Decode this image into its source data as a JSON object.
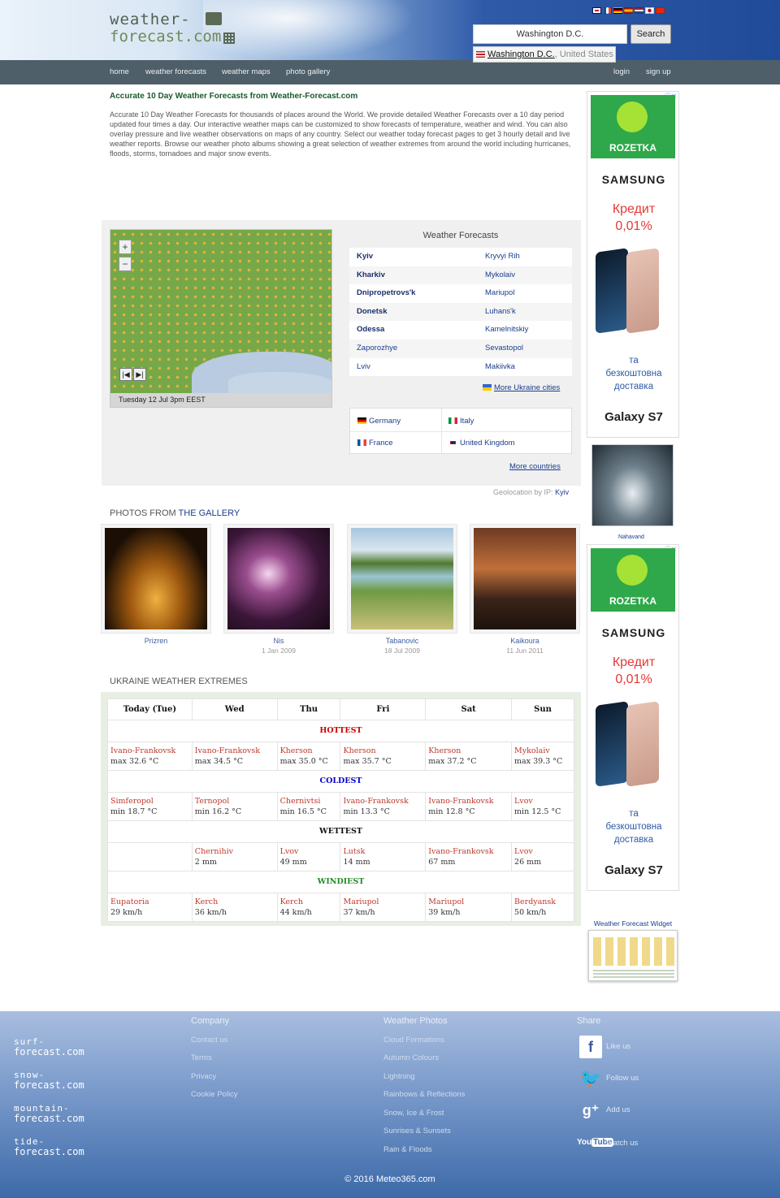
{
  "header": {
    "logo_line1": "weather-",
    "logo_line2": "forecast.com",
    "search_value": "Washington D.C.",
    "search_button": "Search",
    "suggestion_city": "Washington D.C.",
    "suggestion_country": ", United States",
    "flags": [
      "gb-flag-icon",
      "fr-flag-icon",
      "de-flag-icon",
      "es-flag-icon",
      "nl-flag-icon",
      "jp-flag-icon",
      "cn-flag-icon"
    ]
  },
  "nav": {
    "home": "home",
    "forecasts": "weather forecasts",
    "maps": "weather maps",
    "gallery": "photo gallery",
    "login": "login",
    "signup": "sign up"
  },
  "intro": {
    "title": "Accurate 10 Day Weather Forecasts from Weather-Forecast.com",
    "text": "Accurate 10 Day Weather Forecasts for thousands of places around the World. We provide detailed Weather Forecasts over a 10 day period updated four times a day. Our interactive weather maps can be customized to show forecasts of temperature, weather and wind. You can also overlay pressure and live weather observations on maps of any country. Select our weather today forecast pages to get 3 hourly detail and live weather reports. Browse our weather photo albums showing a great selection of weather extremes from around the world including hurricanes, floods, storms, tornadoes and major snow events."
  },
  "map": {
    "caption": "Tuesday 12 Jul 3pm EEST",
    "zoom_in": "+",
    "zoom_out": "−"
  },
  "forecasts": {
    "title": "Weather Forecasts",
    "rows": [
      {
        "left": "Kyiv",
        "right": "Kryvyi Rih",
        "bold": true
      },
      {
        "left": "Kharkiv",
        "right": "Mykolaiv",
        "bold": true
      },
      {
        "left": "Dnipropetrovs'k",
        "right": "Mariupol",
        "bold": true
      },
      {
        "left": "Donetsk",
        "right": "Luhans'k",
        "bold": true
      },
      {
        "left": "Odessa",
        "right": "Kamelnitskiy",
        "bold": true
      },
      {
        "left": "Zaporozhye",
        "right": "Sevastopol",
        "bold": false
      },
      {
        "left": "Lviv",
        "right": "Makiivka",
        "bold": false
      }
    ],
    "more_ukraine": "More Ukraine cities",
    "countries": [
      "Germany",
      "Italy",
      "France",
      "United Kingdom"
    ],
    "more_countries": "More countries",
    "geoloc_label": "Geolocation by IP:",
    "geoloc_city": "Kyiv"
  },
  "gallery": {
    "title_prefix": "PHOTOS FROM ",
    "title_link": "THE GALLERY",
    "photos": [
      {
        "caption": "Prizren",
        "date": ""
      },
      {
        "caption": "Nis",
        "date": "1 Jan 2009"
      },
      {
        "caption": "Tabanovic",
        "date": "18 Jul 2009"
      },
      {
        "caption": "Kaikoura",
        "date": "11 Jun 2011"
      }
    ]
  },
  "extremes": {
    "title": "UKRAINE WEATHER EXTREMES",
    "days": [
      "Today (Tue)",
      "Wed",
      "Thu",
      "Fri",
      "Sat",
      "Sun"
    ],
    "sections": [
      {
        "label": "HOTTEST",
        "color": "#cc0000",
        "cells": [
          {
            "city": "Ivano-Frankovsk",
            "value": "max 32.6 °C"
          },
          {
            "city": "Ivano-Frankovsk",
            "value": "max 34.5 °C"
          },
          {
            "city": "Kherson",
            "value": "max 35.0 °C"
          },
          {
            "city": "Kherson",
            "value": "max 35.7 °C"
          },
          {
            "city": "Kherson",
            "value": "max 37.2 °C"
          },
          {
            "city": "Mykolaiv",
            "value": "max 39.3 °C"
          }
        ]
      },
      {
        "label": "COLDEST",
        "color": "#0000cc",
        "cells": [
          {
            "city": "Simferopol",
            "value": "min 18.7 °C"
          },
          {
            "city": "Ternopol",
            "value": "min 16.2 °C"
          },
          {
            "city": "Chernivtsi",
            "value": "min 16.5 °C"
          },
          {
            "city": "Ivano-Frankovsk",
            "value": "min 13.3 °C"
          },
          {
            "city": "Ivano-Frankovsk",
            "value": "min 12.8 °C"
          },
          {
            "city": "Lvov",
            "value": "min 12.5 °C"
          }
        ]
      },
      {
        "label": "WETTEST",
        "color": "#111111",
        "cells": [
          {
            "city": "",
            "value": ""
          },
          {
            "city": "Chernihiv",
            "value": "2 mm"
          },
          {
            "city": "Lvov",
            "value": "49 mm"
          },
          {
            "city": "Lutsk",
            "value": "14 mm"
          },
          {
            "city": "Ivano-Frankovsk",
            "value": "67 mm"
          },
          {
            "city": "Lvov",
            "value": "26 mm"
          }
        ]
      },
      {
        "label": "WINDIEST",
        "color": "#228b22",
        "cells": [
          {
            "city": "Eupatoria",
            "value": "29 km/h"
          },
          {
            "city": "Kerch",
            "value": "36 km/h"
          },
          {
            "city": "Kerch",
            "value": "44 km/h"
          },
          {
            "city": "Mariupol",
            "value": "37 km/h"
          },
          {
            "city": "Mariupol",
            "value": "39 km/h"
          },
          {
            "city": "Berdyansk",
            "value": "50 km/h"
          }
        ]
      }
    ]
  },
  "sidebar": {
    "ad_brand": "ROZETKA",
    "ad_samsung": "SAMSUNG",
    "ad_kredit_1": "Кредит",
    "ad_kredit_2": "0,01%",
    "ad_ta_1": "та",
    "ad_ta_2": "безкоштовна",
    "ad_ta_3": "доставка",
    "ad_galaxy": "Galaxy S7",
    "photo_caption": "Nahavand",
    "widget_title": "Weather Forecast Widget"
  },
  "footer": {
    "sisters": [
      {
        "a": "surf-",
        "b": "forecast.com"
      },
      {
        "a": "snow-",
        "b": "forecast.com"
      },
      {
        "a": "mountain-",
        "b": "forecast.com"
      },
      {
        "a": "tide-",
        "b": "forecast.com"
      }
    ],
    "company_title": "Company",
    "company_links": [
      "Contact us",
      "Terms",
      "Privacy",
      "Cookie Policy"
    ],
    "photos_title": "Weather Photos",
    "photos_links": [
      "Cloud Formations",
      "Autumn Colours",
      "Lightning",
      "Rainbows & Reflections",
      "Snow, Ice & Frost",
      "Sunrises & Sunsets",
      "Rain & Floods"
    ],
    "share_title": "Share",
    "share": [
      {
        "icon": "facebook-icon",
        "label": "Like us"
      },
      {
        "icon": "twitter-icon",
        "label": "Follow us"
      },
      {
        "icon": "google-plus-icon",
        "label": "Add us"
      },
      {
        "icon": "youtube-icon",
        "label": "Watch us"
      }
    ],
    "copyright": "© 2016 Meteo365.com"
  }
}
